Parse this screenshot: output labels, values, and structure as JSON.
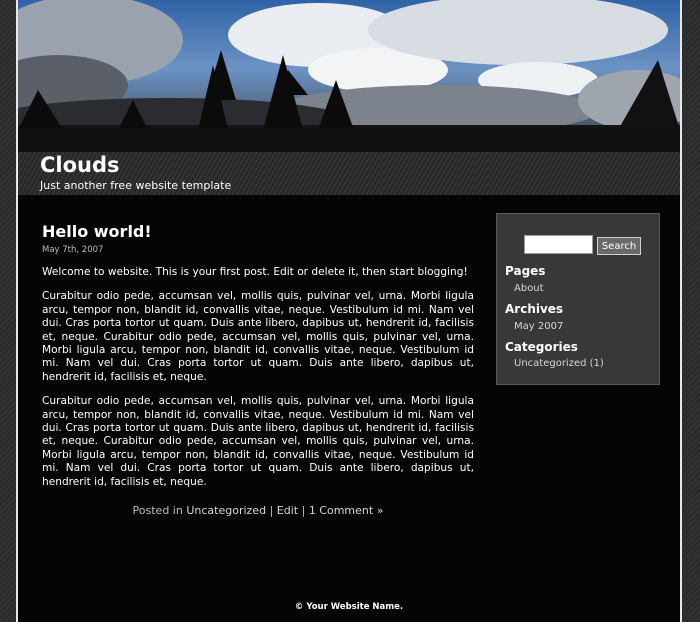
{
  "site": {
    "title": "Clouds",
    "tagline": "Just another free website template"
  },
  "post": {
    "title": "Hello world!",
    "date": "May 7th, 2007",
    "intro": "Welcome to website. This is your first post. Edit or delete it, then start blogging!",
    "paragraphs": [
      "Curabitur odio pede, accumsan vel, mollis quis, pulvinar vel, urna. Morbi ligula arcu, tempor non, blandit id, convallis vitae, neque. Vestibulum id mi. Nam vel dui. Cras porta tortor ut quam. Duis ante libero, dapibus ut, hendrerit id, facilisis et, neque. Curabitur odio pede, accumsan vel, mollis quis, pulvinar vel, urna. Morbi ligula arcu, tempor non, blandit id, convallis vitae, neque. Vestibulum id mi. Nam vel dui. Cras porta tortor ut quam. Duis ante libero, dapibus ut, hendrerit id, facilisis et, neque.",
      "Curabitur odio pede, accumsan vel, mollis quis, pulvinar vel, urna. Morbi ligula arcu, tempor non, blandit id, convallis vitae, neque. Vestibulum id mi. Nam vel dui. Cras porta tortor ut quam. Duis ante libero, dapibus ut, hendrerit id, facilisis et, neque. Curabitur odio pede, accumsan vel, mollis quis, pulvinar vel, urna. Morbi ligula arcu, tempor non, blandit id, convallis vitae, neque. Vestibulum id mi. Nam vel dui. Cras porta tortor ut quam. Duis ante libero, dapibus ut, hendrerit id, facilisis et, neque."
    ],
    "meta": {
      "posted_in": "Posted in",
      "category": "Uncategorized",
      "sep1": "|",
      "edit": "Edit",
      "sep2": "|",
      "comments": "1 Comment »"
    }
  },
  "sidebar": {
    "search_button": "Search",
    "search_value": "",
    "pages_heading": "Pages",
    "pages": [
      "About"
    ],
    "archives_heading": "Archives",
    "archives": [
      "May 2007"
    ],
    "categories_heading": "Categories",
    "categories": [
      "Uncategorized (1)"
    ]
  },
  "footer": {
    "text": "© Your Website Name."
  }
}
